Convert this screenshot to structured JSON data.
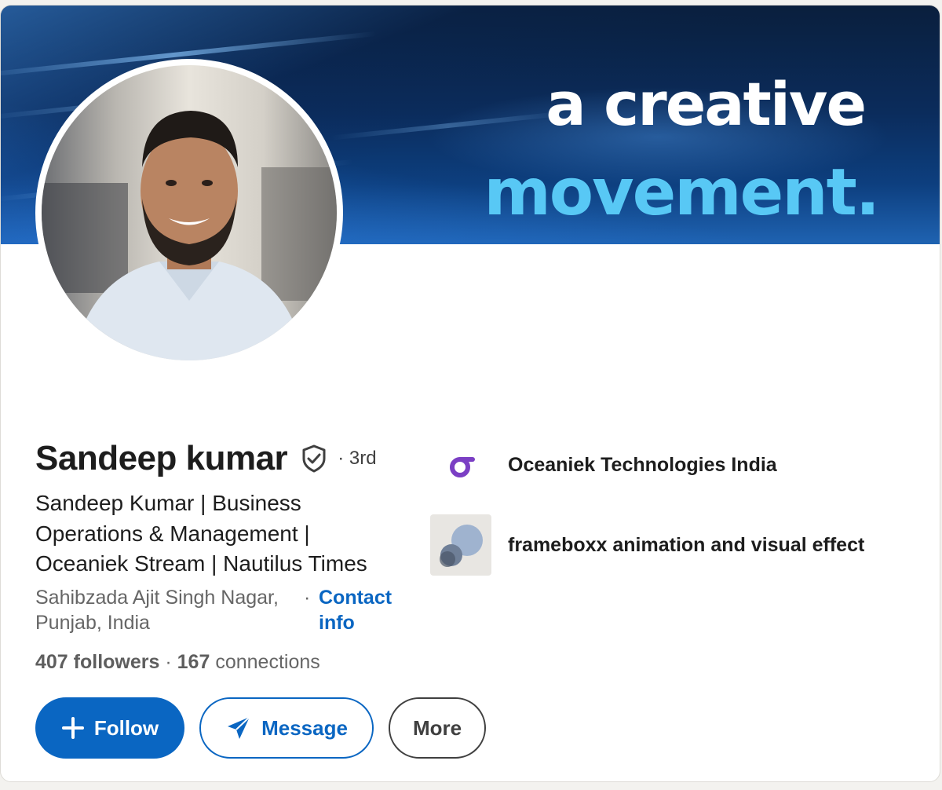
{
  "banner": {
    "line1": "a creative",
    "line2": "movement.",
    "colors": {
      "line1": "#ffffff",
      "line2": "#58c8f5",
      "bg": "#0b2c5c"
    }
  },
  "profile": {
    "avatar_icon": "profile-photo",
    "name": "Sandeep kumar",
    "verified_icon": "shield-check-icon",
    "degree": "· 3rd",
    "headline": "Sandeep Kumar | Business Operations & Management | Oceaniek Stream | Nautilus Times",
    "location": "Sahibzada Ajit Singh Nagar, Punjab, India",
    "location_separator": "·",
    "contact_info_label": "Contact info",
    "followers_count": "407",
    "followers_label": "followers",
    "stats_separator": "·",
    "connections_count": "167",
    "connections_label": "connections"
  },
  "actions": {
    "follow_label": "Follow",
    "follow_icon": "plus-icon",
    "message_label": "Message",
    "message_icon": "send-icon",
    "more_label": "More"
  },
  "companies": [
    {
      "name": "Oceaniek Technologies India",
      "logo": "oceaniek-logo"
    },
    {
      "name": "frameboxx animation and visual effect",
      "logo": "frameboxx-logo"
    }
  ],
  "colors": {
    "accent": "#0a66c2",
    "text_primary": "#1d1d1d",
    "text_secondary": "#666666",
    "oceaniek_logo": "#7b3fc4"
  }
}
